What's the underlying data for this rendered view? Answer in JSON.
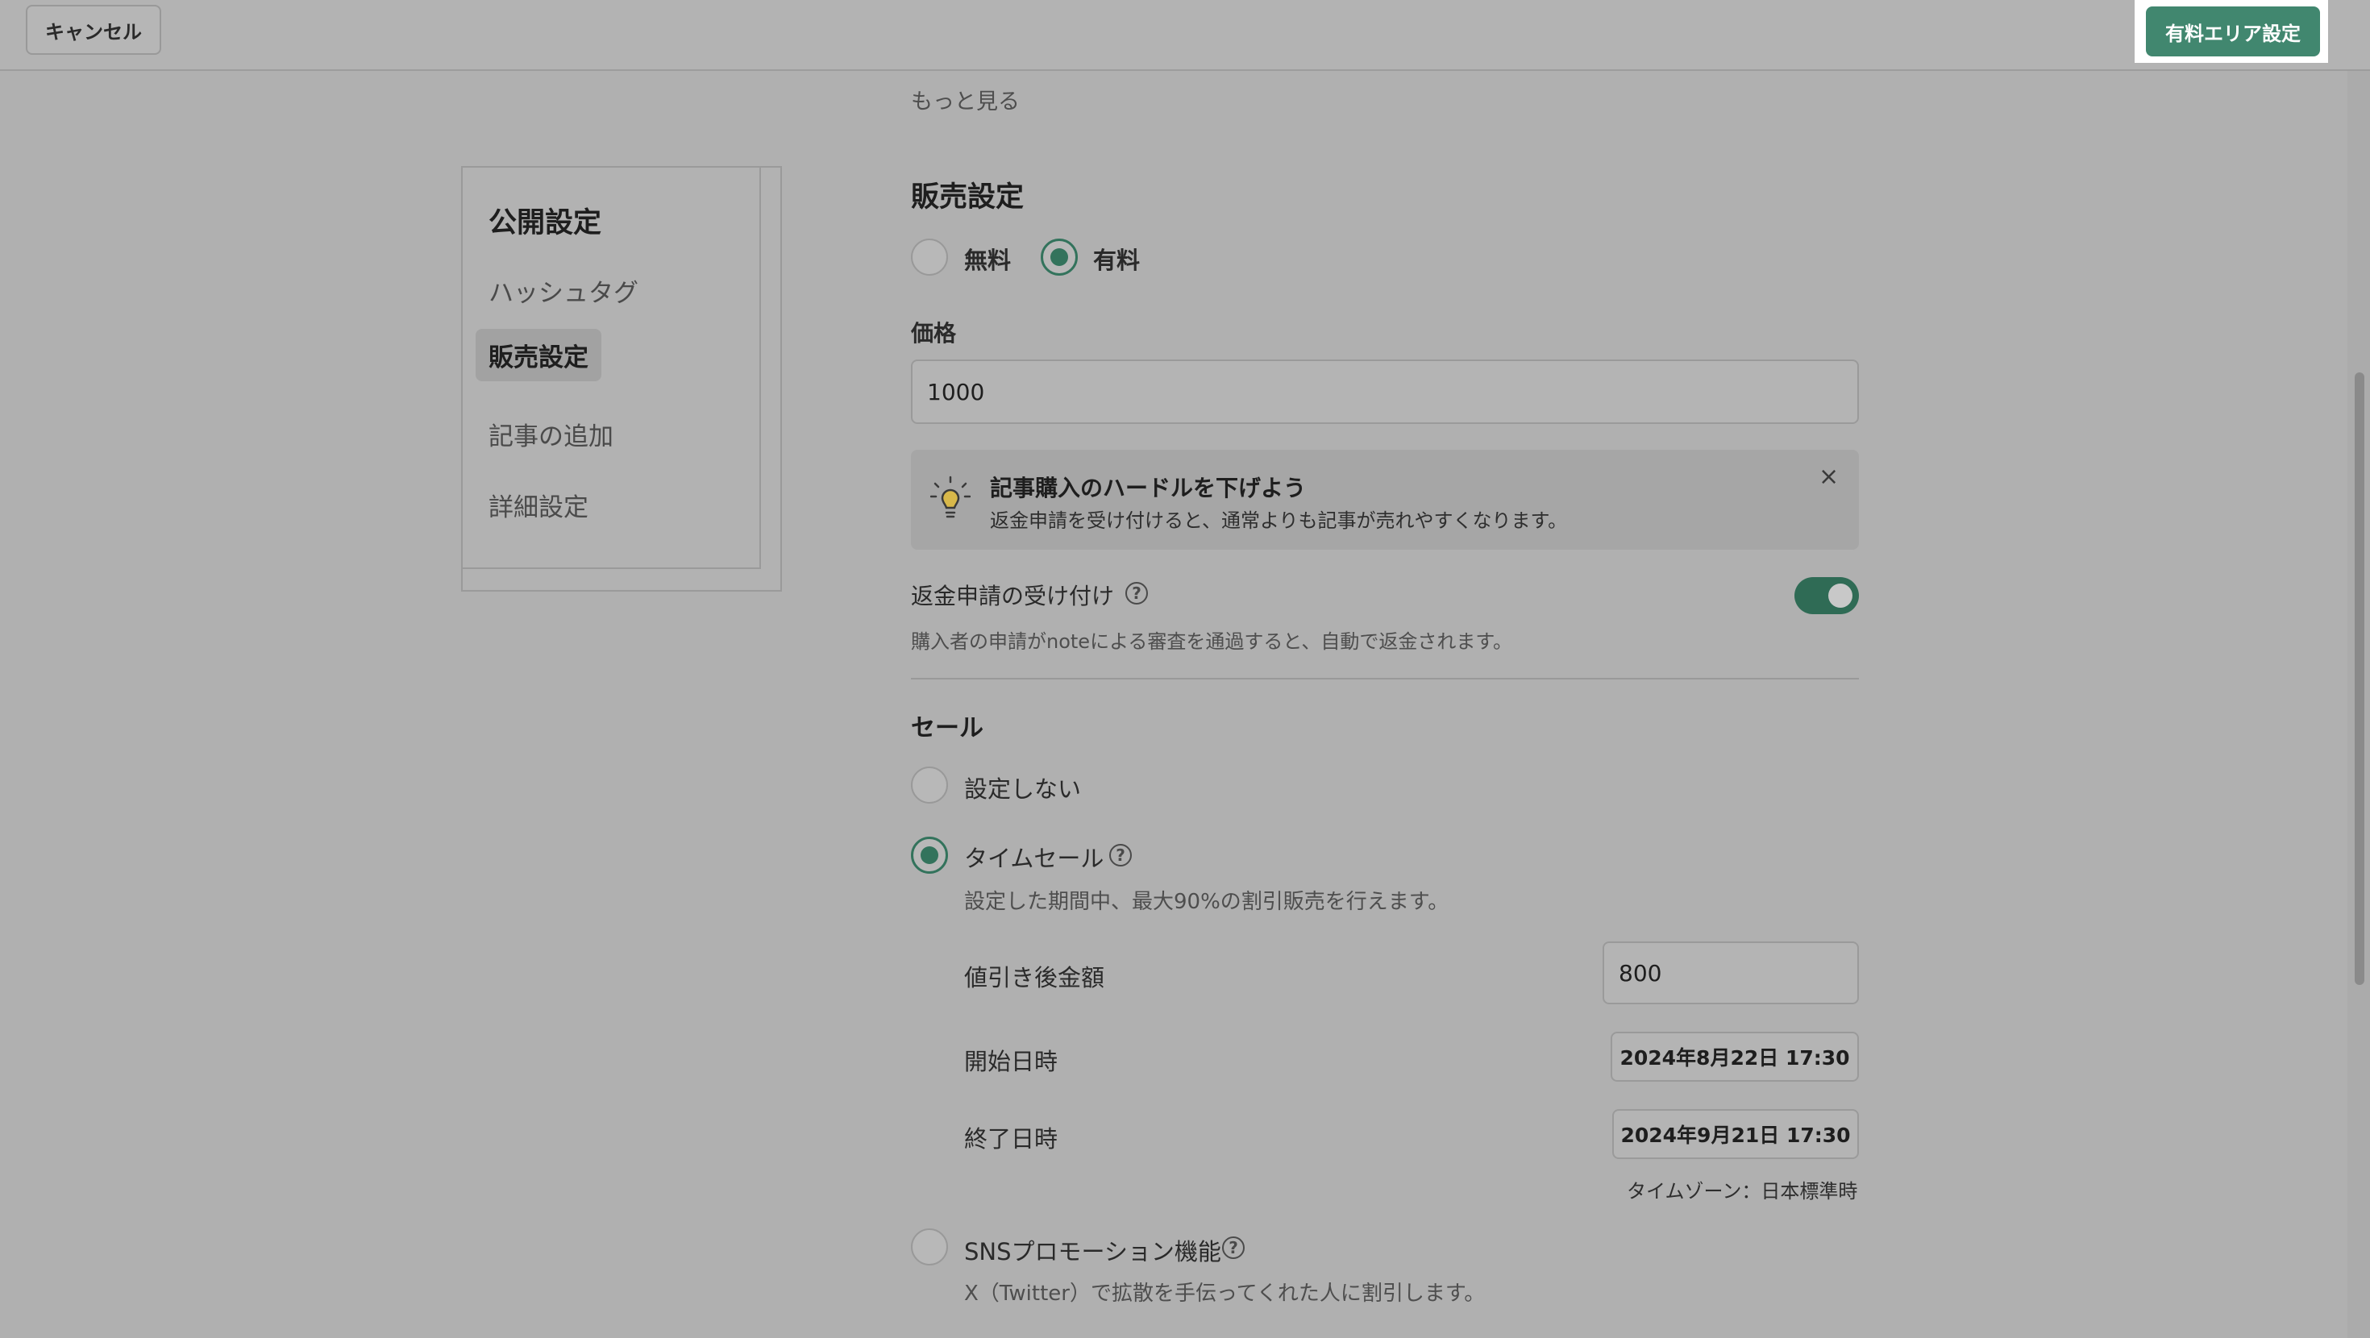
{
  "header": {
    "cancel_label": "キャンセル",
    "primary_label": "有料エリア設定",
    "primary_color": "#41876f"
  },
  "more_link": "もっと見る",
  "sidenav": {
    "title": "公開設定",
    "items": [
      {
        "label": "ハッシュタグ",
        "active": false
      },
      {
        "label": "販売設定",
        "active": true
      },
      {
        "label": "記事の追加",
        "active": false
      },
      {
        "label": "詳細設定",
        "active": false
      }
    ]
  },
  "sales": {
    "title": "販売設定",
    "options": [
      {
        "label": "無料",
        "selected": false
      },
      {
        "label": "有料",
        "selected": true
      }
    ],
    "price_label": "価格",
    "price_value": "1000",
    "tip": {
      "icon": "lightbulb-icon",
      "title": "記事購入のハードルを下げよう",
      "text": "返金申請を受け付けると、通常よりも記事が売れやすくなります。",
      "close_icon": "close-icon"
    },
    "refund": {
      "label": "返金申請の受け付け",
      "enabled": true,
      "description": "購入者の申請がnoteによる審査を通過すると、自動で返金されます。"
    }
  },
  "sale": {
    "title": "セール",
    "none_label": "設定しない",
    "time_sale": {
      "label": "タイムセール",
      "selected": true,
      "description": "設定した期間中、最大90%の割引販売を行えます。",
      "discount_label": "値引き後金額",
      "discount_value": "800",
      "start_label": "開始日時",
      "start_value": "2024年8月22日 17:30",
      "end_label": "終了日時",
      "end_value": "2024年9月21日 17:30",
      "timezone": "タイムゾーン：日本標準時"
    },
    "sns": {
      "label": "SNSプロモーション機能",
      "selected": false,
      "description": "X（Twitter）で拡散を手伝ってくれた人に割引します。"
    }
  },
  "help_glyph": "?",
  "close_glyph": "×"
}
